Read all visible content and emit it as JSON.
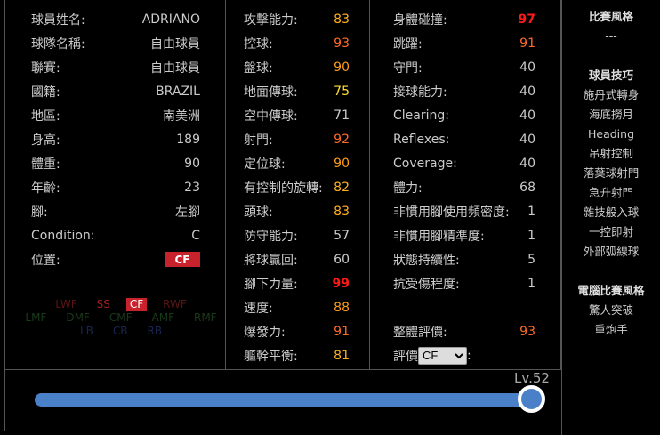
{
  "info": [
    {
      "label": "球員姓名:",
      "value": "ADRIANO"
    },
    {
      "label": "球隊名稱:",
      "value": "自由球員"
    },
    {
      "label": "聯賽:",
      "value": "自由球員"
    },
    {
      "label": "國籍:",
      "value": "BRAZIL"
    },
    {
      "label": "地區:",
      "value": "南美洲"
    },
    {
      "label": "身高:",
      "value": "189"
    },
    {
      "label": "體重:",
      "value": "90"
    },
    {
      "label": "年齡:",
      "value": "23"
    },
    {
      "label": "腳:",
      "value": "左腳"
    },
    {
      "label": "Condition:",
      "value": "C"
    },
    {
      "label": "位置:",
      "value": "CF"
    }
  ],
  "positions": {
    "row1": [
      "LWF",
      "SS",
      "CF",
      "RWF"
    ],
    "row2": [
      "LMF",
      "DMF",
      "CMF",
      "AMF",
      "RMF"
    ],
    "row3": [
      "LB",
      "CB",
      "RB"
    ],
    "selected": "CF"
  },
  "stats1": [
    {
      "label": "攻擊能力:",
      "value": "83"
    },
    {
      "label": "控球:",
      "value": "93"
    },
    {
      "label": "盤球:",
      "value": "90"
    },
    {
      "label": "地面傳球:",
      "value": "75"
    },
    {
      "label": "空中傳球:",
      "value": "71"
    },
    {
      "label": "射門:",
      "value": "92"
    },
    {
      "label": "定位球:",
      "value": "90"
    },
    {
      "label": "有控制的旋轉:",
      "value": "82"
    },
    {
      "label": "頭球:",
      "value": "83"
    },
    {
      "label": "防守能力:",
      "value": "57"
    },
    {
      "label": "將球贏回:",
      "value": "60"
    },
    {
      "label": "腳下力量:",
      "value": "99"
    },
    {
      "label": "速度:",
      "value": "88"
    },
    {
      "label": "爆發力:",
      "value": "91"
    },
    {
      "label": "軀幹平衡:",
      "value": "81"
    }
  ],
  "stats2": [
    {
      "label": "身體碰撞:",
      "value": "97"
    },
    {
      "label": "跳躍:",
      "value": "91"
    },
    {
      "label": "守門:",
      "value": "40"
    },
    {
      "label": "接球能力:",
      "value": "40"
    },
    {
      "label": "Clearing:",
      "value": "40"
    },
    {
      "label": "Reflexes:",
      "value": "40"
    },
    {
      "label": "Coverage:",
      "value": "40"
    },
    {
      "label": "體力:",
      "value": "68"
    },
    {
      "label": "非慣用腳使用頻密度:",
      "value": "1"
    },
    {
      "label": "非慣用腳精準度:",
      "value": "1"
    },
    {
      "label": "狀態持續性:",
      "value": "5"
    },
    {
      "label": "抗受傷程度:",
      "value": "1"
    }
  ],
  "overall": {
    "label": "整體評價:",
    "value": "93"
  },
  "rating": {
    "label": "評價",
    "selected": "CF",
    "suffix": ":"
  },
  "side": {
    "style_title": "比賽風格",
    "style_value": "---",
    "skills_title": "球員技巧",
    "skills": [
      "施丹式轉身",
      "海底撈月",
      "Heading",
      "吊射控制",
      "落葉球射門",
      "急升射門",
      "雜技般入球",
      "一控即射",
      "外部弧線球"
    ],
    "ai_title": "電腦比賽風格",
    "ai": [
      "驚人突破",
      "重炮手"
    ]
  },
  "level": {
    "label": "Lv.52",
    "value": 52
  }
}
